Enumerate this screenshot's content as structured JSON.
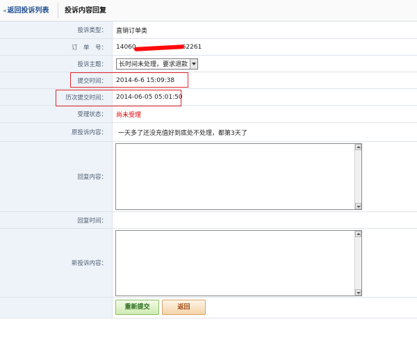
{
  "header": {
    "back_label": "返回投诉列表",
    "title": "投诉内容回复"
  },
  "fields": {
    "type_label": "投诉类型：",
    "type_value": "直销订单类",
    "order_label": "订　单　号：",
    "order_value": "14060",
    "order_value_tail": "62261",
    "subject_label": "投诉主题：",
    "subject_value": "长时间未处理，要求退款",
    "submit_time_label": "提交时间：",
    "submit_time_value": "2014-6-6 15:09:38",
    "history_time_label": "历次提交时间：",
    "history_time_value": "2014-06-05 05:01:50",
    "status_label": "受理状态：",
    "status_value": "尚未受理",
    "original_label": "原投诉内容：",
    "original_value": "一天多了还没充值好到底处不处理，都第3天了",
    "reply_label": "回复内容：",
    "reply_time_label": "回复时间：",
    "new_content_label": "新投诉内容："
  },
  "buttons": {
    "resubmit": "重新提交",
    "back": "返回"
  },
  "colors": {
    "label_bg": "#eef3f9",
    "status_red": "#e00000",
    "highlight_box": "#e3262b",
    "link_blue": "#1f4e93"
  }
}
